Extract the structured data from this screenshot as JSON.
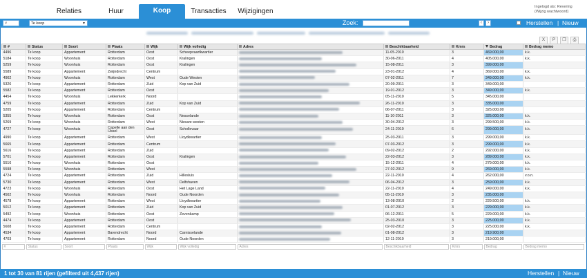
{
  "tabs": [
    {
      "label": "Relaties",
      "active": false
    },
    {
      "label": "Huur",
      "active": false
    },
    {
      "label": "Koop",
      "active": true
    },
    {
      "label": "Transacties",
      "active": false
    },
    {
      "label": "Wijzigingen",
      "active": false
    }
  ],
  "login": {
    "line1": "Ingelogd als: Revering",
    "line2": "(Wijzig wachtwoord)"
  },
  "toolbar": {
    "id_placeholder": "#",
    "select_value": "Te koop",
    "search_label": "Zoek:",
    "prev_icon": "chevron-left-icon",
    "next_icon": "chevron-right-icon",
    "reset_label": "Herstellen",
    "new_label": "Nieuw",
    "separator": "|"
  },
  "icons": {
    "export_excel": "excel-icon",
    "export_pdf": "pdf-icon",
    "copy": "copy-icon",
    "print": "print-icon"
  },
  "colors": {
    "accent": "#2b8fd6",
    "amount_highlight": "#a9d3f2"
  },
  "columns": [
    "#",
    "Status",
    "Soort",
    "Plaats",
    "Wijk",
    "Wijk volledig",
    "Adres",
    "Beschikbaarheid",
    "Kmrs",
    "Bedrag",
    "Bedrag memo"
  ],
  "rows": [
    {
      "id": "4496",
      "status": "Te koop",
      "soort": "Appartement",
      "plaats": "Rotterdam",
      "wijk": "Oost",
      "wijk_volledig": "Scheepvaartkwartier",
      "datum": "11-05-2010",
      "kmrs": "3",
      "bedrag": "469.000,00",
      "memo": "k.k."
    },
    {
      "id": "5184",
      "status": "Te koop",
      "soort": "Woonhuis",
      "plaats": "Rotterdam",
      "wijk": "Oost",
      "wijk_volledig": "Kralingen",
      "datum": "30-06-2011",
      "kmrs": "4",
      "bedrag": "405.000,00",
      "memo": "k.k."
    },
    {
      "id": "5259",
      "status": "Te koop",
      "soort": "Woonhuis",
      "plaats": "Rotterdam",
      "wijk": "Oost",
      "wijk_volledig": "Kralingen",
      "datum": "15-08-2011",
      "kmrs": "3",
      "bedrag": "399.000,00",
      "memo": ""
    },
    {
      "id": "5589",
      "status": "Te koop",
      "soort": "Appartement",
      "plaats": "Zwijndrecht",
      "wijk": "Centrum",
      "wijk_volledig": "",
      "datum": "23-01-2012",
      "kmrs": "4",
      "bedrag": "369.000,00",
      "memo": "k.k."
    },
    {
      "id": "4902",
      "status": "Te koop",
      "soort": "Woonhuis",
      "plaats": "Rotterdam",
      "wijk": "West",
      "wijk_volledig": "Oude Westen",
      "datum": "07-02-2011",
      "kmrs": "7",
      "bedrag": "349.000,00",
      "memo": "k.k."
    },
    {
      "id": "5326",
      "status": "Te koop",
      "soort": "Appartement",
      "plaats": "Rotterdam",
      "wijk": "Zuid",
      "wijk_volledig": "Kop van Zuid",
      "datum": "20-09-2011",
      "kmrs": "3",
      "bedrag": "349.000,00",
      "memo": ""
    },
    {
      "id": "5582",
      "status": "Te koop",
      "soort": "Appartement",
      "plaats": "Rotterdam",
      "wijk": "Oost",
      "wijk_volledig": "",
      "datum": "19-01-2012",
      "kmrs": "3",
      "bedrag": "349.000,00",
      "memo": "k.k."
    },
    {
      "id": "4454",
      "status": "Te koop",
      "soort": "Woonhuis",
      "plaats": "Lekkerkerk",
      "wijk": "Noord",
      "wijk_volledig": "",
      "datum": "05-11-2010",
      "kmrs": "5",
      "bedrag": "345.000,00",
      "memo": ""
    },
    {
      "id": "4759",
      "status": "Te koop",
      "soort": "Appartement",
      "plaats": "Rotterdam",
      "wijk": "Zuid",
      "wijk_volledig": "Kop van Zuid",
      "datum": "26-11-2010",
      "kmrs": "3",
      "bedrag": "335.000,00",
      "memo": ""
    },
    {
      "id": "5205",
      "status": "Te koop",
      "soort": "Appartement",
      "plaats": "Rotterdam",
      "wijk": "Centrum",
      "wijk_volledig": "",
      "datum": "06-07-2011",
      "kmrs": "3",
      "bedrag": "325.000,00",
      "memo": ""
    },
    {
      "id": "5355",
      "status": "Te koop",
      "soort": "Woonhuis",
      "plaats": "Rotterdam",
      "wijk": "Oost",
      "wijk_volledig": "Nesselande",
      "datum": "11-10-2011",
      "kmrs": "3",
      "bedrag": "325.000,00",
      "memo": "k.k."
    },
    {
      "id": "5269",
      "status": "Te koop",
      "soort": "Woonhuis",
      "plaats": "Rotterdam",
      "wijk": "West",
      "wijk_volledig": "Nieuwe westen",
      "datum": "30-04-2012",
      "kmrs": "3",
      "bedrag": "299.500,00",
      "memo": "k.k."
    },
    {
      "id": "4727",
      "status": "Te koop",
      "soort": "Woonhuis",
      "plaats": "Capelle aan den IJssel",
      "wijk": "Oost",
      "wijk_volledig": "Schollevaar",
      "datum": "24-11-2010",
      "kmrs": "6",
      "bedrag": "299.000,00",
      "memo": "k.k.",
      "tall": true
    },
    {
      "id": "4990",
      "status": "Te koop",
      "soort": "Appartement",
      "plaats": "Rotterdam",
      "wijk": "West",
      "wijk_volledig": "Lloydkwartier",
      "datum": "25-03-2011",
      "kmrs": "3",
      "bedrag": "299.000,00",
      "memo": "k.k."
    },
    {
      "id": "5665",
      "status": "Te koop",
      "soort": "Appartement",
      "plaats": "Rotterdam",
      "wijk": "Centrum",
      "wijk_volledig": "",
      "datum": "07-03-2012",
      "kmrs": "3",
      "bedrag": "299.000,00",
      "memo": "k.k."
    },
    {
      "id": "5616",
      "status": "Te koop",
      "soort": "Appartement",
      "plaats": "Rotterdam",
      "wijk": "Zuid",
      "wijk_volledig": "",
      "datum": "09-02-2012",
      "kmrs": "2",
      "bedrag": "292.000,00",
      "memo": "k.k."
    },
    {
      "id": "5701",
      "status": "Te koop",
      "soort": "Appartement",
      "plaats": "Rotterdam",
      "wijk": "Oost",
      "wijk_volledig": "Kralingen",
      "datum": "22-03-2012",
      "kmrs": "3",
      "bedrag": "289.000,00",
      "memo": "k.k."
    },
    {
      "id": "5516",
      "status": "Te koop",
      "soort": "Woonhuis",
      "plaats": "Rotterdam",
      "wijk": "Oost",
      "wijk_volledig": "",
      "datum": "15-12-2011",
      "kmrs": "4",
      "bedrag": "279.000,00",
      "memo": "k.k."
    },
    {
      "id": "5598",
      "status": "Te koop",
      "soort": "Woonhuis",
      "plaats": "Rotterdam",
      "wijk": "West",
      "wijk_volledig": "",
      "datum": "27-02-2012",
      "kmrs": "9",
      "bedrag": "269.000,00",
      "memo": "k.k."
    },
    {
      "id": "4724",
      "status": "Te koop",
      "soort": "Appartement",
      "plaats": "Rotterdam",
      "wijk": "Zuid",
      "wijk_volledig": "Hillesluis",
      "datum": "22-11-2010",
      "kmrs": "4",
      "bedrag": "262.000,00",
      "memo": "v.o.n."
    },
    {
      "id": "5730",
      "status": "Te koop",
      "soort": "Appartement",
      "plaats": "Rotterdam",
      "wijk": "West",
      "wijk_volledig": "Delfshaven",
      "datum": "06-04-2012",
      "kmrs": "3",
      "bedrag": "259.000,00",
      "memo": "k.k."
    },
    {
      "id": "4723",
      "status": "Te koop",
      "soort": "Woonhuis",
      "plaats": "Rotterdam",
      "wijk": "Oost",
      "wijk_volledig": "Het Lage Land",
      "datum": "22-11-2010",
      "kmrs": "4",
      "bedrag": "249.000,00",
      "memo": "k.k."
    },
    {
      "id": "4502",
      "status": "Te koop",
      "soort": "Woonhuis",
      "plaats": "Rotterdam",
      "wijk": "Noord",
      "wijk_volledig": "Oude Noorden",
      "datum": "05-11-2010",
      "kmrs": "3",
      "bedrag": "235.000,00",
      "memo": ""
    },
    {
      "id": "4578",
      "status": "Te koop",
      "soort": "Appartement",
      "plaats": "Rotterdam",
      "wijk": "West",
      "wijk_volledig": "Lloydkwartier",
      "datum": "13-08-2010",
      "kmrs": "2",
      "bedrag": "229.500,00",
      "memo": "k.k."
    },
    {
      "id": "5012",
      "status": "Te koop",
      "soort": "Appartement",
      "plaats": "Rotterdam",
      "wijk": "Zuid",
      "wijk_volledig": "Kop van Zuid",
      "datum": "01-07-2012",
      "kmrs": "3",
      "bedrag": "229.000,00",
      "memo": "k.k."
    },
    {
      "id": "5492",
      "status": "Te koop",
      "soort": "Woonhuis",
      "plaats": "Rotterdam",
      "wijk": "Oost",
      "wijk_volledig": "Zevenkamp",
      "datum": "06-12-2011",
      "kmrs": "5",
      "bedrag": "229.000,00",
      "memo": "k.k."
    },
    {
      "id": "4474",
      "status": "Te koop",
      "soort": "Appartement",
      "plaats": "Rotterdam",
      "wijk": "Oost",
      "wijk_volledig": "",
      "datum": "25-03-2010",
      "kmrs": "3",
      "bedrag": "225.000,00",
      "memo": "k.k."
    },
    {
      "id": "5608",
      "status": "Te koop",
      "soort": "Appartement",
      "plaats": "Rotterdam",
      "wijk": "Centrum",
      "wijk_volledig": "",
      "datum": "02-02-2012",
      "kmrs": "3",
      "bedrag": "225.000,00",
      "memo": "k.k."
    },
    {
      "id": "4534",
      "status": "Te koop",
      "soort": "Appartement",
      "plaats": "Barendrecht",
      "wijk": "Noord",
      "wijk_volledig": "Carnisselande",
      "datum": "01-08-2012",
      "kmrs": "3",
      "bedrag": "219.900,00",
      "memo": ""
    },
    {
      "id": "4703",
      "status": "Te koop",
      "soort": "Appartement",
      "plaats": "Rotterdam",
      "wijk": "Noord",
      "wijk_volledig": "Oude Noorden",
      "datum": "12-11-2010",
      "kmrs": "3",
      "bedrag": "219.000,00",
      "memo": ""
    }
  ],
  "filters": [
    "#",
    "Status",
    "Soort",
    "Plaats",
    "Wijk",
    "Wijk volledig",
    "Adres",
    "Beschikbaarheid",
    "Kmrs",
    "Bedrag",
    "Bedrag memo"
  ],
  "footer": {
    "info": "1 tot 30 van 81 rijen (gefilterd uit 4,437 rijen)",
    "reset_label": "Herstellen",
    "new_label": "Nieuw",
    "separator": "|"
  }
}
